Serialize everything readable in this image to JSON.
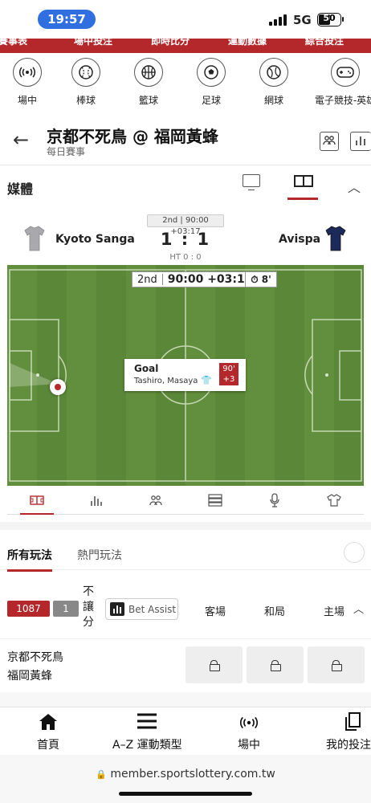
{
  "status": {
    "time": "19:57",
    "network": "5G",
    "battery": "50"
  },
  "top_strip": [
    "賽事表",
    "場中投注",
    "即時比分",
    "運動數據",
    "綜合投注"
  ],
  "sports": [
    {
      "label": "場中",
      "icon": "live-icon"
    },
    {
      "label": "棒球",
      "icon": "baseball-icon"
    },
    {
      "label": "籃球",
      "icon": "basketball-icon"
    },
    {
      "label": "足球",
      "icon": "soccer-icon"
    },
    {
      "label": "網球",
      "icon": "tennis-icon"
    },
    {
      "label": "電子競技-英雄",
      "icon": "gamepad-icon"
    }
  ],
  "header": {
    "title": "京都不死鳥 @ 福岡黃蜂",
    "subtitle": "每日賽事"
  },
  "media": {
    "title": "媒體"
  },
  "match": {
    "period": "2nd | 90:00 +03:17",
    "home": "Kyoto Sanga",
    "away": "Avispa",
    "score": "1 : 1",
    "ht": "HT 0 : 0",
    "clock_half": "2nd",
    "clock_time": "90:00 +03:17",
    "added": "8'",
    "event_title": "Goal",
    "event_player": "Tashiro, Masaya",
    "event_minute": "90'",
    "event_plus": "+3"
  },
  "markets": {
    "all": "所有玩法",
    "hot": "熱門玩法"
  },
  "odds": {
    "badge_count": "1087",
    "badge_small": "1",
    "handicap": [
      "不",
      "讓",
      "分"
    ],
    "bet_assist": "Bet Assist",
    "cols": [
      "客場",
      "和局",
      "主場"
    ]
  },
  "row": {
    "team1": "京都不死鳥",
    "team2": "福岡黃蜂"
  },
  "bottom_nav": [
    {
      "label": "首頁",
      "icon": "home-icon"
    },
    {
      "label": "A–Z 運動類型",
      "icon": "menu-icon"
    },
    {
      "label": "場中",
      "icon": "live-icon"
    },
    {
      "label": "我的投注",
      "icon": "betslip-icon"
    }
  ],
  "url": "member.sportslottery.com.tw",
  "colors": {
    "brand_red": "#b4282c",
    "pitch_green": "#5e8a3a"
  }
}
